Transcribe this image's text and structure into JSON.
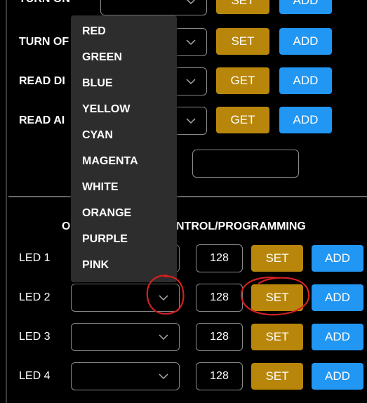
{
  "top_rows": [
    {
      "label": "TURN ON",
      "action": "SET",
      "add": "ADD"
    },
    {
      "label": "TURN OF",
      "action": "SET",
      "add": "ADD"
    },
    {
      "label": "READ DI",
      "action": "GET",
      "add": "ADD"
    },
    {
      "label": "READ AI",
      "action": "GET",
      "add": "ADD"
    }
  ],
  "section_title_left": "O",
  "section_title_right": "NTROL/PROGRAMMING",
  "led_rows": [
    {
      "label": "LED 1",
      "value": "128",
      "action": "SET",
      "add": "ADD"
    },
    {
      "label": "LED 2",
      "value": "128",
      "action": "SET",
      "add": "ADD"
    },
    {
      "label": "LED 3",
      "value": "128",
      "action": "SET",
      "add": "ADD"
    },
    {
      "label": "LED 4",
      "value": "128",
      "action": "SET",
      "add": "ADD"
    }
  ],
  "color_options": [
    "RED",
    "GREEN",
    "BLUE",
    "YELLOW",
    "CYAN",
    "MAGENTA",
    "WHITE",
    "ORANGE",
    "PURPLE",
    "PINK"
  ],
  "colors": {
    "gold": "#b8860b",
    "blue": "#2196f3",
    "dropdown_bg": "#2d2d2d",
    "annotation_red": "#d42020"
  }
}
